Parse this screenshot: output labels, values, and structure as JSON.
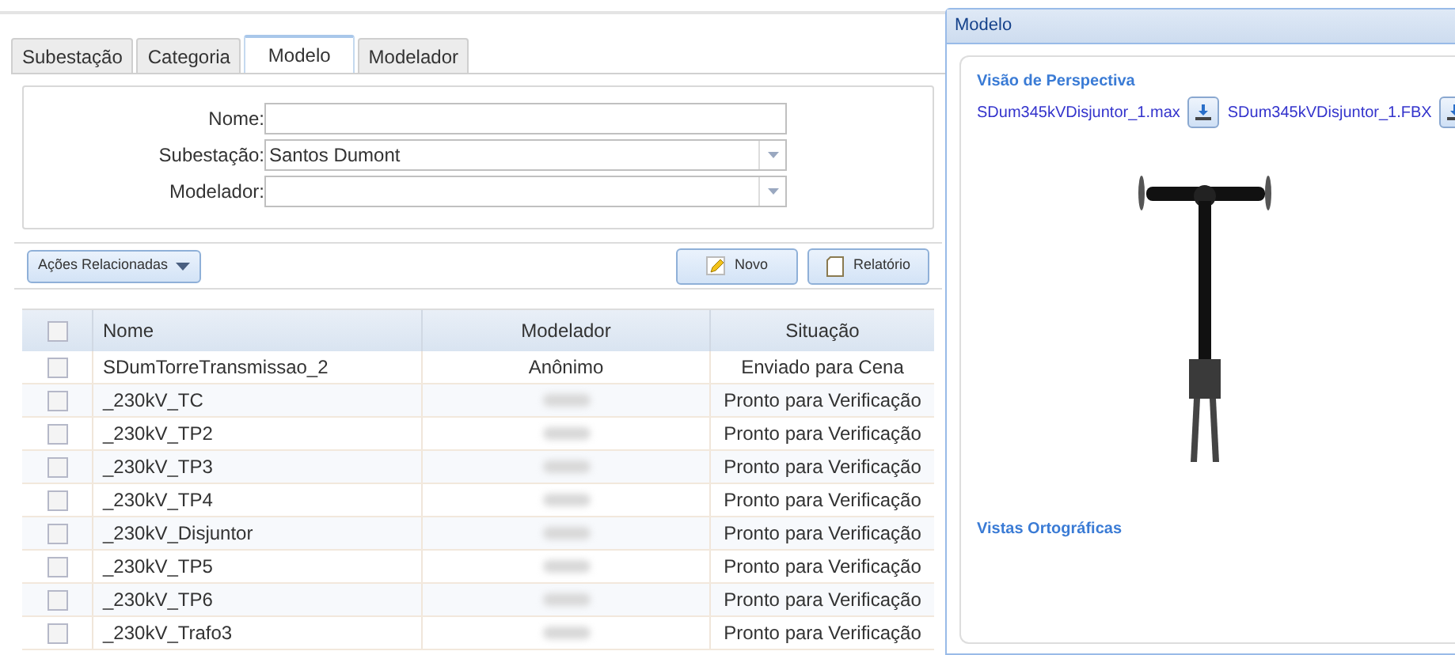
{
  "tabs": [
    {
      "label": "Subestação",
      "selected": false
    },
    {
      "label": "Categoria",
      "selected": false
    },
    {
      "label": "Modelo",
      "selected": true
    },
    {
      "label": "Modelador",
      "selected": false
    }
  ],
  "form": {
    "fields": [
      {
        "label": "Nome:",
        "kind": "text"
      },
      {
        "label": "Subestação:",
        "kind": "select",
        "value": "Santos Dumont"
      },
      {
        "label": "Modelador:",
        "kind": "select"
      }
    ]
  },
  "toolbar": {
    "related_actions": "Ações Relacionadas",
    "buttons": [
      {
        "label": "Novo",
        "kind": "new"
      },
      {
        "label": "Relatório",
        "kind": "report"
      }
    ]
  },
  "table": {
    "columns": [
      "Nome",
      "Modelador",
      "Situação"
    ],
    "header_checked": false,
    "rows": [
      {
        "nome": "SDumTorreTransmissao_2",
        "modelador": "Anônimo",
        "modelador_blurred": false,
        "situacao": "Enviado para Cena",
        "checked": false
      },
      {
        "nome": "_230kV_TC",
        "modelador_blurred": true,
        "situacao": "Pronto para Verificação",
        "checked": false
      },
      {
        "nome": "_230kV_TP2",
        "modelador_blurred": true,
        "situacao": "Pronto para Verificação",
        "checked": false
      },
      {
        "nome": "_230kV_TP3",
        "modelador_blurred": true,
        "situacao": "Pronto para Verificação",
        "checked": false
      },
      {
        "nome": "_230kV_TP4",
        "modelador_blurred": true,
        "situacao": "Pronto para Verificação",
        "checked": false
      },
      {
        "nome": "_230kV_Disjuntor",
        "modelador_blurred": true,
        "situacao": "Pronto para Verificação",
        "checked": false
      },
      {
        "nome": "_230kV_TP5",
        "modelador_blurred": true,
        "situacao": "Pronto para Verificação",
        "checked": false
      },
      {
        "nome": "_230kV_TP6",
        "modelador_blurred": true,
        "situacao": "Pronto para Verificação",
        "checked": false
      },
      {
        "nome": "_230kV_Trafo3",
        "modelador_blurred": true,
        "situacao": "Pronto para Verificação",
        "checked": false
      }
    ]
  },
  "panel": {
    "title": "Modelo",
    "perspective_title": "Visão de Perspectiva",
    "files": [
      "SDum345kVDisjuntor_1.max",
      "SDum345kVDisjuntor_1.FBX"
    ],
    "ortho_title": "Vistas Ortográficas"
  }
}
